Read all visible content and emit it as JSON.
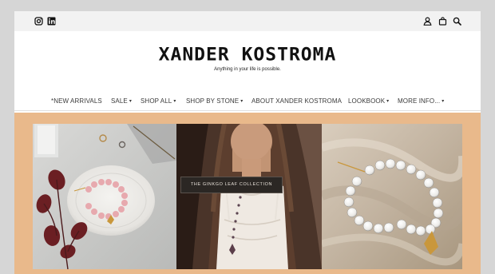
{
  "topbar": {
    "social": [
      {
        "icon": "instagram-icon"
      },
      {
        "icon": "linkedin-icon"
      }
    ],
    "utility": [
      {
        "icon": "account-icon"
      },
      {
        "icon": "cart-icon"
      },
      {
        "icon": "search-icon"
      }
    ]
  },
  "header": {
    "logo": "XANDER KOSTROMA",
    "tagline": "Anything in your life is possible."
  },
  "nav": {
    "items": [
      {
        "label": "*NEW ARRIVALS",
        "dropdown": false
      },
      {
        "label": "SALE",
        "dropdown": true
      },
      {
        "label": "SHOP ALL",
        "dropdown": true
      },
      {
        "label": "SHOP BY STONE",
        "dropdown": true
      },
      {
        "label": "ABOUT XANDER KOSTROMA",
        "dropdown": false
      },
      {
        "label": "LOOKBOOK",
        "dropdown": true
      },
      {
        "label": "MORE INFO...",
        "dropdown": true
      }
    ]
  },
  "hero": {
    "cta_label": "THE GINKGO LEAF COLLECTION",
    "background": "#e9b98b"
  },
  "colors": {
    "topbar_bg": "#f2f2f2",
    "hero_bg": "#e9b98b",
    "cta_bg": "#2b2724",
    "nav_text": "#3a3a3a"
  }
}
